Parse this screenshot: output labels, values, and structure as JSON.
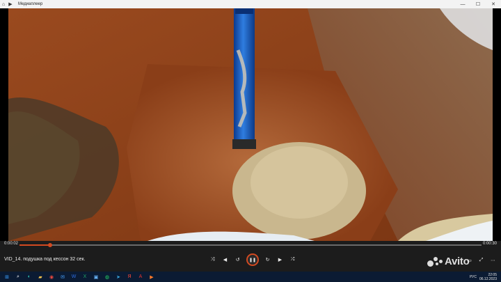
{
  "window": {
    "title": "Медиаплеер",
    "controls": {
      "minimize": "—",
      "maximize": "☐",
      "close": "✕"
    }
  },
  "player": {
    "current_time": "0:00:02",
    "total_time": "0:00:30",
    "progress_fraction": 0.067,
    "video_name": "VID_14. подушка под кессон 32 сек.",
    "accent_color": "#d24a21"
  },
  "controls": {
    "left": [
      {
        "name": "shuffle-icon",
        "glyph": "⤨"
      },
      {
        "name": "previous-icon",
        "glyph": "◀"
      },
      {
        "name": "rewind-icon",
        "glyph": "↺"
      }
    ],
    "play_pause": {
      "name": "pause-icon",
      "glyph": "❚❚"
    },
    "right": [
      {
        "name": "forward-icon",
        "glyph": "↻"
      },
      {
        "name": "next-icon",
        "glyph": "▶"
      },
      {
        "name": "repeat-icon",
        "glyph": "⤮"
      }
    ],
    "extra": [
      {
        "name": "cast-icon",
        "glyph": "▭"
      },
      {
        "name": "fullscreen-icon",
        "glyph": "⤢"
      },
      {
        "name": "more-icon",
        "glyph": "⋯"
      }
    ]
  },
  "watermark": {
    "text": "Avito"
  },
  "taskbar": {
    "icons": [
      {
        "name": "start-icon",
        "glyph": "⊞",
        "color": "#3aa0ff"
      },
      {
        "name": "search-icon",
        "glyph": "⌕",
        "color": "#ffffff"
      },
      {
        "name": "edge-icon",
        "glyph": "◐",
        "color": "#2ec4b6"
      },
      {
        "name": "folder-icon",
        "glyph": "▰",
        "color": "#f2c14e"
      },
      {
        "name": "chrome-icon",
        "glyph": "◉",
        "color": "#e9483f"
      },
      {
        "name": "mail-icon",
        "glyph": "✉",
        "color": "#4aa3ff"
      },
      {
        "name": "word-icon",
        "glyph": "W",
        "color": "#2f6ee0"
      },
      {
        "name": "excel-icon",
        "glyph": "X",
        "color": "#21a366"
      },
      {
        "name": "photos-icon",
        "glyph": "▣",
        "color": "#6ab7ff"
      },
      {
        "name": "whatsapp-icon",
        "glyph": "◍",
        "color": "#25d366"
      },
      {
        "name": "telegram-icon",
        "glyph": "➤",
        "color": "#39a8e0"
      },
      {
        "name": "yandex-icon",
        "glyph": "Я",
        "color": "#ff4b3a"
      },
      {
        "name": "pdf-icon",
        "glyph": "A",
        "color": "#e3342f"
      },
      {
        "name": "media-player-icon",
        "glyph": "▶",
        "color": "#ff7a29"
      }
    ],
    "language": "РУС",
    "time": "22:05",
    "date": "06.12.2023"
  }
}
